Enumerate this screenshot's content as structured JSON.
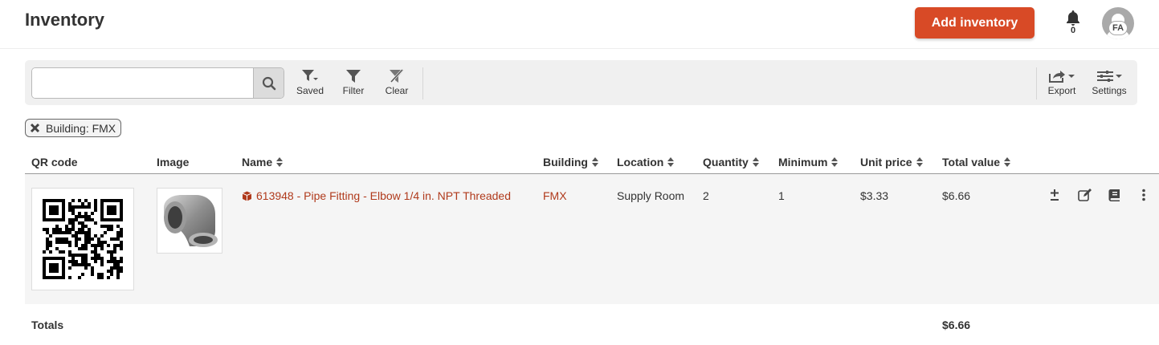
{
  "header": {
    "title": "Inventory",
    "add_button_label": "Add inventory",
    "notification_count": "0",
    "avatar_initials": "FA",
    "brand_color": "#d84a26"
  },
  "toolbar": {
    "search": {
      "value": "",
      "placeholder": ""
    },
    "tools": [
      {
        "label": "Saved",
        "icon": "saved-filter-icon"
      },
      {
        "label": "Filter",
        "icon": "filter-icon"
      },
      {
        "label": "Clear",
        "icon": "clear-filter-icon"
      },
      {
        "label": "Export",
        "icon": "export-icon"
      },
      {
        "label": "Settings",
        "icon": "settings-sliders-icon"
      }
    ]
  },
  "active_filters": [
    {
      "label": "Building: FMX"
    }
  ],
  "table": {
    "columns": [
      "QR code",
      "Image",
      "Name",
      "Building",
      "Location",
      "Quantity",
      "Minimum",
      "Unit price",
      "Total value"
    ],
    "rows": [
      {
        "name": "613948 - Pipe Fitting - Elbow 1/4 in. NPT Threaded",
        "building": "FMX",
        "location": "Supply Room",
        "quantity": "2",
        "minimum": "1",
        "unit_price": "$3.33",
        "total_value": "$6.66"
      }
    ],
    "totals": {
      "label": "Totals",
      "total_value": "$6.66"
    }
  },
  "colors": {
    "link": "#b03a1c",
    "row_background": "#f5f5f5",
    "toolbar_background": "#f0f0f0"
  }
}
